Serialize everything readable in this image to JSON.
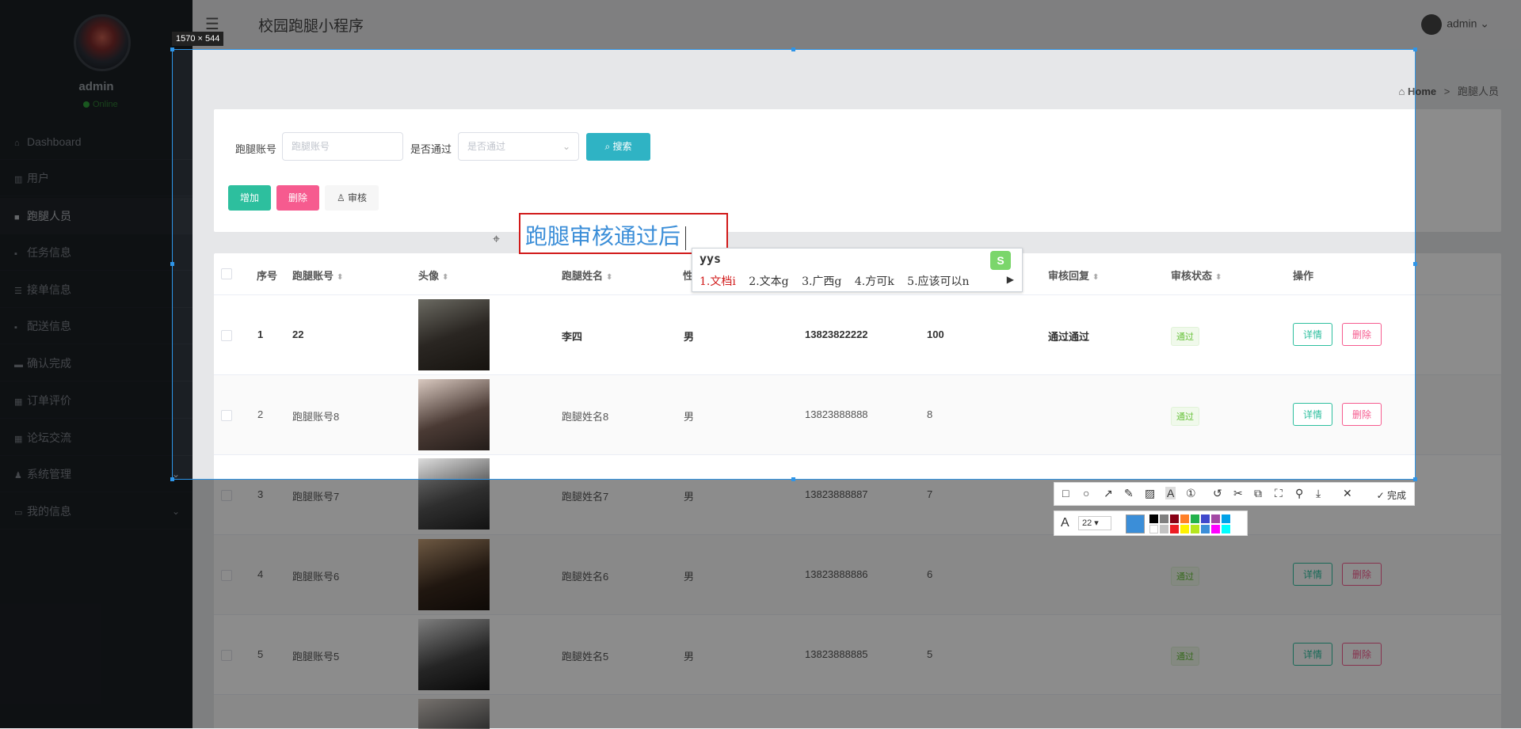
{
  "sidebar": {
    "user": "admin",
    "status": "Online",
    "items": [
      {
        "label": "Dashboard",
        "icon": "home-icon"
      },
      {
        "label": "用户",
        "icon": "bar-chart-icon"
      },
      {
        "label": "跑腿人员",
        "icon": "camera-icon"
      },
      {
        "label": "任务信息",
        "icon": "book-icon"
      },
      {
        "label": "接单信息",
        "icon": "list-icon"
      },
      {
        "label": "配送信息",
        "icon": "book-icon"
      },
      {
        "label": "确认完成",
        "icon": "folder-icon"
      },
      {
        "label": "订单评价",
        "icon": "grid-icon"
      },
      {
        "label": "论坛交流",
        "icon": "grid-icon"
      },
      {
        "label": "系统管理",
        "icon": "user-icon"
      },
      {
        "label": "我的信息",
        "icon": "card-icon"
      }
    ]
  },
  "header": {
    "title": "校园跑腿小程序",
    "user": "admin"
  },
  "breadcrumb": {
    "home": "Home",
    "sep": ">",
    "current": "跑腿人员"
  },
  "filters": {
    "account_label": "跑腿账号",
    "account_placeholder": "跑腿账号",
    "pass_label": "是否通过",
    "pass_placeholder": "是否通过",
    "search_label": "搜索"
  },
  "actions": {
    "add": "增加",
    "delete": "删除",
    "audit": "审核"
  },
  "table": {
    "headers": [
      "序号",
      "跑腿账号",
      "头像",
      "跑腿姓名",
      "性",
      "审核回复",
      "审核状态",
      "操作"
    ],
    "rows": [
      {
        "no": "1",
        "account": "22",
        "name": "李四",
        "gender": "男",
        "phone": "13823822222",
        "score": "100",
        "reply": "通过通过",
        "status": "通过"
      },
      {
        "no": "2",
        "account": "跑腿账号8",
        "name": "跑腿姓名8",
        "gender": "男",
        "phone": "13823888888",
        "score": "8",
        "reply": "",
        "status": "通过"
      },
      {
        "no": "3",
        "account": "跑腿账号7",
        "name": "跑腿姓名7",
        "gender": "男",
        "phone": "13823888887",
        "score": "7",
        "reply": "",
        "status": "通过"
      },
      {
        "no": "4",
        "account": "跑腿账号6",
        "name": "跑腿姓名6",
        "gender": "男",
        "phone": "13823888886",
        "score": "6",
        "reply": "",
        "status": "通过"
      },
      {
        "no": "5",
        "account": "跑腿账号5",
        "name": "跑腿姓名5",
        "gender": "男",
        "phone": "13823888885",
        "score": "5",
        "reply": "",
        "status": "通过"
      }
    ],
    "detail_label": "详情",
    "delete_label": "删除"
  },
  "screenshot_tool": {
    "size_label": "1570 × 544",
    "annotation_text": "跑腿审核通过后",
    "ime_input": "yys",
    "ime_candidates": [
      "1.文档i",
      "2.文本g",
      "3.广西g",
      "4.方可k",
      "5.应该可以n"
    ],
    "font_size": "22",
    "done_label": "完成",
    "selected_color": "#3b8ed8",
    "palette": [
      "#000000",
      "#7f7f7f",
      "#880015",
      "#ff7f27",
      "#22b14c",
      "#3f48cc",
      "#a349a4",
      "#00a2e8",
      "#ffffff",
      "#c3c3c3",
      "#ed1c24",
      "#fff200",
      "#b5e61d",
      "#3b8ed8",
      "#ff00ff",
      "#00ffff"
    ]
  }
}
